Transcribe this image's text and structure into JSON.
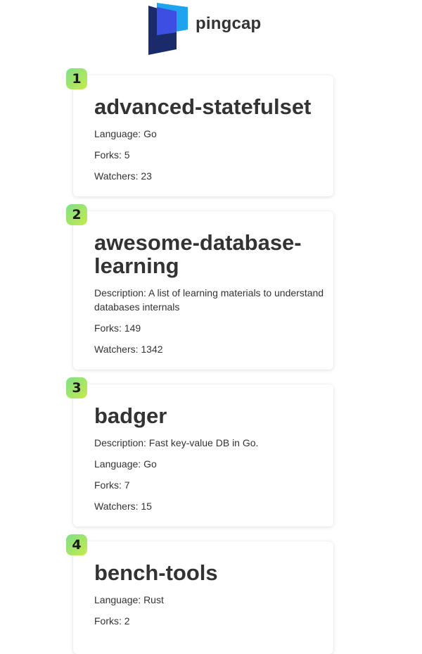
{
  "header": {
    "logo_icon": "pingcap-logo-icon",
    "brand_name": "pingcap",
    "colors": {
      "logo_light": "#1fa3f0",
      "logo_mid": "#3d4fe0",
      "logo_dark": "#1b2a6b"
    }
  },
  "badge_colors": {
    "start": "#7ee08a",
    "end": "#c6ea4a"
  },
  "repos": [
    {
      "rank": "1",
      "name": "advanced-statefulset",
      "language": "Language: Go",
      "forks": "Forks: 5",
      "watchers": "Watchers: 23"
    },
    {
      "rank": "2",
      "name": "awesome-database-learning",
      "description": "Description: A list of learning materials to understand databases internals",
      "forks": "Forks: 149",
      "watchers": "Watchers: 1342"
    },
    {
      "rank": "3",
      "name": "badger",
      "description": "Description: Fast key-value DB in Go.",
      "language": "Language: Go",
      "forks": "Forks: 7",
      "watchers": "Watchers: 15"
    },
    {
      "rank": "4",
      "name": "bench-tools",
      "language": "Language: Rust",
      "forks": "Forks: 2"
    }
  ]
}
